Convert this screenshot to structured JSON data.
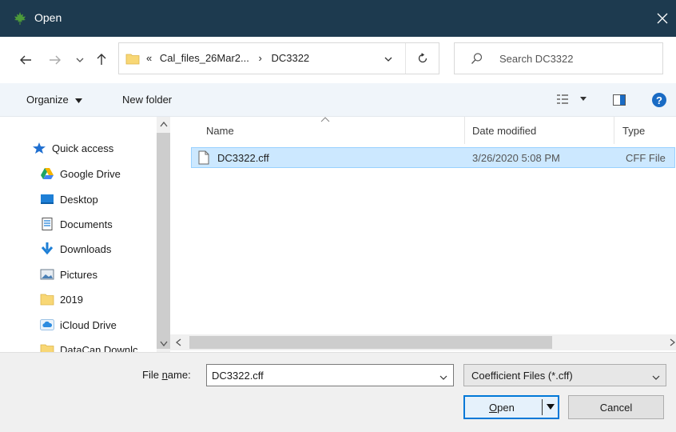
{
  "window": {
    "title": "Open",
    "app_icon": "maple-leaf-icon",
    "close_icon": "close-icon"
  },
  "nav": {
    "back_icon": "arrow-left-icon",
    "forward_icon": "arrow-right-icon",
    "recent_icon": "chevron-down-icon",
    "up_icon": "arrow-up-icon"
  },
  "address": {
    "overflow": "«",
    "crumb1": "Cal_files_26Mar2...",
    "sep": "›",
    "crumb2": "DC3322",
    "refresh_icon": "refresh-icon"
  },
  "search": {
    "placeholder": "Search DC3322"
  },
  "toolbar": {
    "organize_label": "Organize",
    "new_folder_label": "New folder"
  },
  "sidebar": {
    "items": [
      {
        "label": "Quick access",
        "icon": "star-icon"
      },
      {
        "label": "Google Drive",
        "icon": "google-drive-icon"
      },
      {
        "label": "Desktop",
        "icon": "desktop-icon"
      },
      {
        "label": "Documents",
        "icon": "documents-icon"
      },
      {
        "label": "Downloads",
        "icon": "download-icon"
      },
      {
        "label": "Pictures",
        "icon": "pictures-icon"
      },
      {
        "label": "2019",
        "icon": "folder-icon"
      },
      {
        "label": "iCloud Drive",
        "icon": "cloud-icon"
      },
      {
        "label": "DataCan Downlc",
        "icon": "folder-icon"
      }
    ]
  },
  "files": {
    "columns": {
      "name": "Name",
      "date": "Date modified",
      "type": "Type"
    },
    "rows": [
      {
        "name": "DC3322.cff",
        "date": "3/26/2020 5:08 PM",
        "type": "CFF File"
      }
    ]
  },
  "footer": {
    "file_name_label_pre": "File ",
    "file_name_label_mnemonic": "n",
    "file_name_label_post": "ame:",
    "file_name_value": "DC3322.cff",
    "file_type_value": "Coefficient Files (*.cff)",
    "open_pre": "",
    "open_mnemonic": "O",
    "open_post": "pen",
    "cancel_label": "Cancel"
  },
  "colors": {
    "titlebar": "#1d3a4f",
    "selection": "#cce8ff",
    "accent": "#0078d7"
  }
}
